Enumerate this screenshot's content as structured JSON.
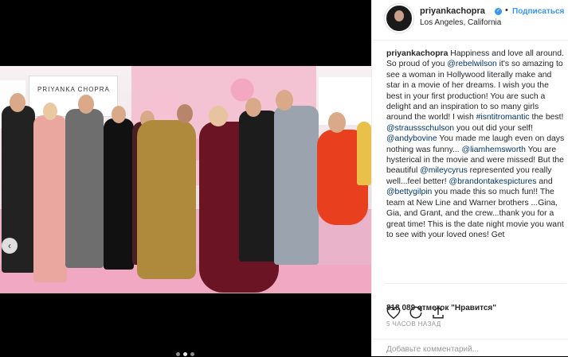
{
  "header": {
    "username": "priyankachopra",
    "separator": "•",
    "follow_label": "Подписаться",
    "location": "Los Angeles, California"
  },
  "photo": {
    "sign_left_text": "PRIYANKA CHOPRA",
    "slide_count": 3,
    "active_slide": 2
  },
  "caption": {
    "author": "priyankachopra",
    "segments": [
      {
        "type": "text",
        "value": " Happiness and love all around. So proud of you "
      },
      {
        "type": "mention",
        "value": "@rebelwilson"
      },
      {
        "type": "text",
        "value": " it's so amazing to see a woman in Hollywood literally make and star in a movie of her dreams. I wish you the best in your first production! You are such a delight and an inspiration to so many girls around the world! I wish "
      },
      {
        "type": "mention",
        "value": "#isntitromantic"
      },
      {
        "type": "text",
        "value": " the best! "
      },
      {
        "type": "mention",
        "value": "@straussschulson"
      },
      {
        "type": "text",
        "value": " you out did your self! "
      },
      {
        "type": "mention",
        "value": "@andybovine"
      },
      {
        "type": "text",
        "value": " You made me laugh even on days nothing was funny... "
      },
      {
        "type": "mention",
        "value": "@liamhemsworth"
      },
      {
        "type": "text",
        "value": " You are hysterical in the movie and were missed! But the beautiful "
      },
      {
        "type": "mention",
        "value": "@mileycyrus"
      },
      {
        "type": "text",
        "value": " represented you really well...feel better! "
      },
      {
        "type": "mention",
        "value": "@brandontakespictures"
      },
      {
        "type": "text",
        "value": " and "
      },
      {
        "type": "mention",
        "value": "@bettygilpin"
      },
      {
        "type": "text",
        "value": " you made this so much fun!! The team at New Line and Warner brothers ...Gina, Gia, and Grant, and the crew...thank you for a great time! This is the date night movie you want to see with your loved ones! Get"
      }
    ]
  },
  "actions": {
    "like_icon": "heart-icon",
    "comment_icon": "comment-icon",
    "share_icon": "share-icon"
  },
  "likes_text": "818 089 отметок \"Нравится\"",
  "time_ago": "5 ЧАСОВ НАЗАД",
  "comment_placeholder": "Добавьте комментарий..."
}
